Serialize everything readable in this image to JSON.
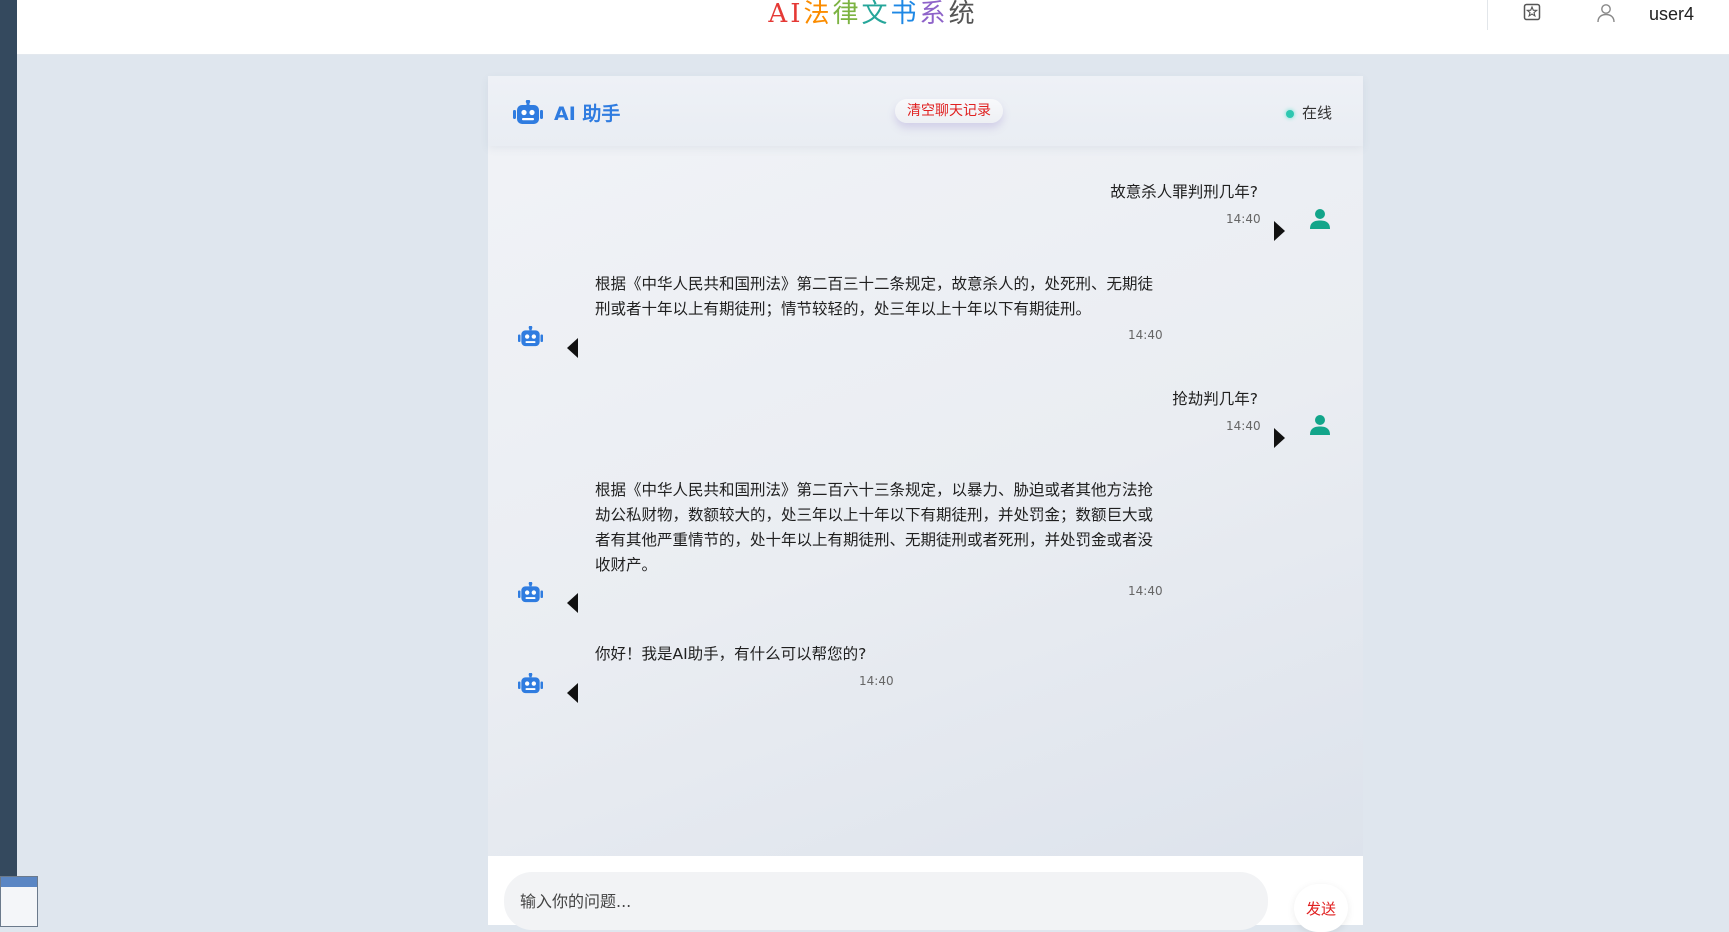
{
  "header": {
    "brand_chars": [
      {
        "char": "A",
        "color": "#e53935"
      },
      {
        "char": "I",
        "color": "#e53935"
      },
      {
        "char": "法",
        "color": "#fb8c00"
      },
      {
        "char": "律",
        "color": "#7cb342"
      },
      {
        "char": "文",
        "color": "#26a69a"
      },
      {
        "char": "书",
        "color": "#1e88e5"
      },
      {
        "char": "系",
        "color": "#8e63c9"
      },
      {
        "char": "统",
        "color": "#555555"
      }
    ],
    "username": "user4"
  },
  "chat": {
    "title": "AI 助手",
    "clear_label": "清空聊天记录",
    "status_label": "在线",
    "messages": [
      {
        "role": "user",
        "text": "故意杀人罪判刑几年?",
        "time": "14:40"
      },
      {
        "role": "assistant",
        "text": "根据《中华人民共和国刑法》第二百三十二条规定，故意杀人的，处死刑、无期徒刑或者十年以上有期徒刑；情节较轻的，处三年以上十年以下有期徒刑。",
        "time": "14:40"
      },
      {
        "role": "user",
        "text": "抢劫判几年?",
        "time": "14:40"
      },
      {
        "role": "assistant",
        "text": "根据《中华人民共和国刑法》第二百六十三条规定，以暴力、胁迫或者其他方法抢劫公私财物，数额较大的，处三年以上十年以下有期徒刑，并处罚金；数额巨大或者有其他严重情节的，处十年以上有期徒刑、无期徒刑或者死刑，并处罚金或者没收财产。",
        "time": "14:40"
      },
      {
        "role": "assistant",
        "text": "你好！我是AI助手，有什么可以帮您的?",
        "time": "14:40"
      }
    ]
  },
  "input": {
    "placeholder": "输入你的问题...",
    "send_label": "发送"
  },
  "colors": {
    "accent": "#2f7ce0",
    "user_avatar": "#12a58a",
    "danger": "#e02020",
    "online": "#2ec7b0"
  },
  "icons": [
    "robot-icon",
    "user-icon",
    "theme-icon",
    "user-outline-icon"
  ]
}
